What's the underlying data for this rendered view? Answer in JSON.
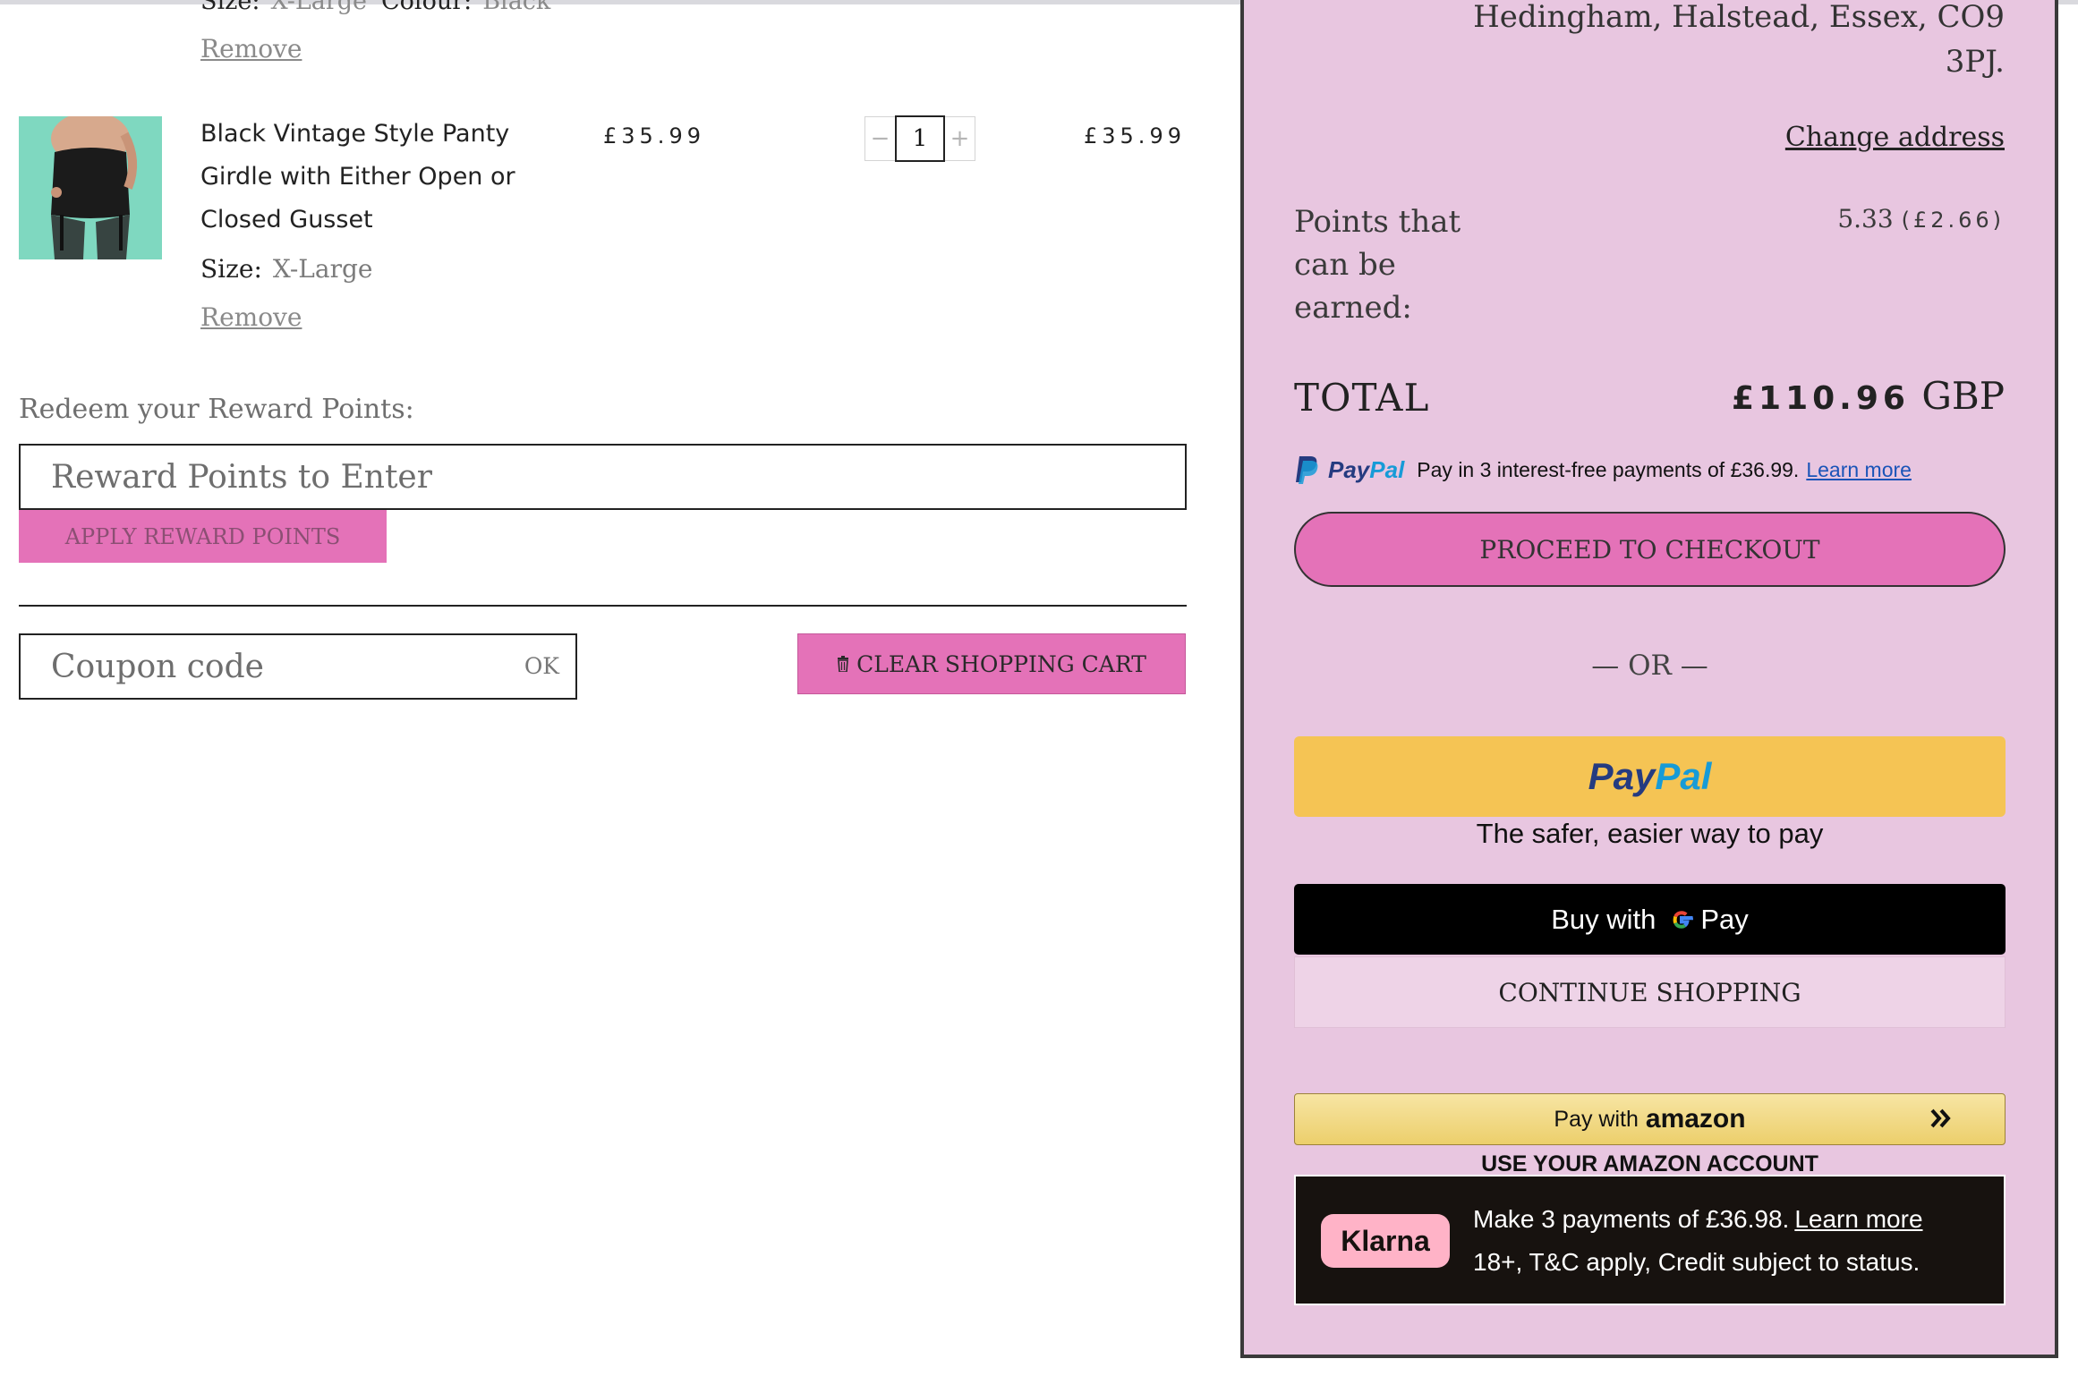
{
  "previous_item": {
    "size_label": "Size:",
    "size_value": "X-Large",
    "colour_label": "Colour:",
    "colour_value": "Black",
    "remove_label": "Remove"
  },
  "item": {
    "name": "Black Vintage Style Panty Girdle with Either Open or Closed Gusset",
    "unit_price": "£35.99",
    "quantity": "1",
    "minus_symbol": "−",
    "plus_symbol": "+",
    "line_total": "£35.99",
    "size_label": "Size:",
    "size_value": "X-Large",
    "remove_label": "Remove"
  },
  "rewards": {
    "label": "Redeem your Reward Points:",
    "placeholder": "Reward Points to Enter",
    "apply_label": "APPLY REWARD POINTS"
  },
  "coupon": {
    "placeholder": "Coupon code",
    "ok_label": "OK"
  },
  "clear_cart_label": "CLEAR SHOPPING CART",
  "summary": {
    "address_line1": "Hedingham, Halstead, Essex, CO9",
    "address_line2": "3PJ.",
    "change_address_label": "Change address",
    "points_label": "Points that can be earned:",
    "points_value": "5.33",
    "points_money": "(£2.66)",
    "total_label": "TOTAL",
    "total_amount": "£110.96",
    "total_currency": "GBP"
  },
  "paypal_message": {
    "brand_pay": "Pay",
    "brand_pal": "Pal",
    "text": "Pay in 3 interest-free payments of £36.99.",
    "learn_more": "Learn more"
  },
  "checkout_label": "PROCEED TO CHECKOUT",
  "or_label": "— OR —",
  "paypal_button": {
    "brand_pay": "Pay",
    "brand_pal": "Pal",
    "tagline": "The safer, easier way to pay"
  },
  "gpay": {
    "prefix": "Buy with",
    "suffix": "Pay"
  },
  "continue_label": "CONTINUE SHOPPING",
  "amazon": {
    "prefix": "Pay with",
    "brand": "amazon",
    "note": "USE YOUR AMAZON ACCOUNT"
  },
  "klarna": {
    "badge": "Klarna",
    "line1": "Make 3 payments of £36.98.",
    "learn_more": "Learn more",
    "line2": "18+, T&C apply, Credit subject to status."
  },
  "colors": {
    "accent_pink": "#e472b8",
    "summary_bg": "#e8c6e0",
    "paypal_yellow": "#f5c454",
    "klarna_pink": "#ffb3c7"
  },
  "icons": [
    "trash-icon",
    "paypal-p-icon",
    "google-g-icon",
    "double-chevron-right-icon",
    "product-thumbnail"
  ]
}
